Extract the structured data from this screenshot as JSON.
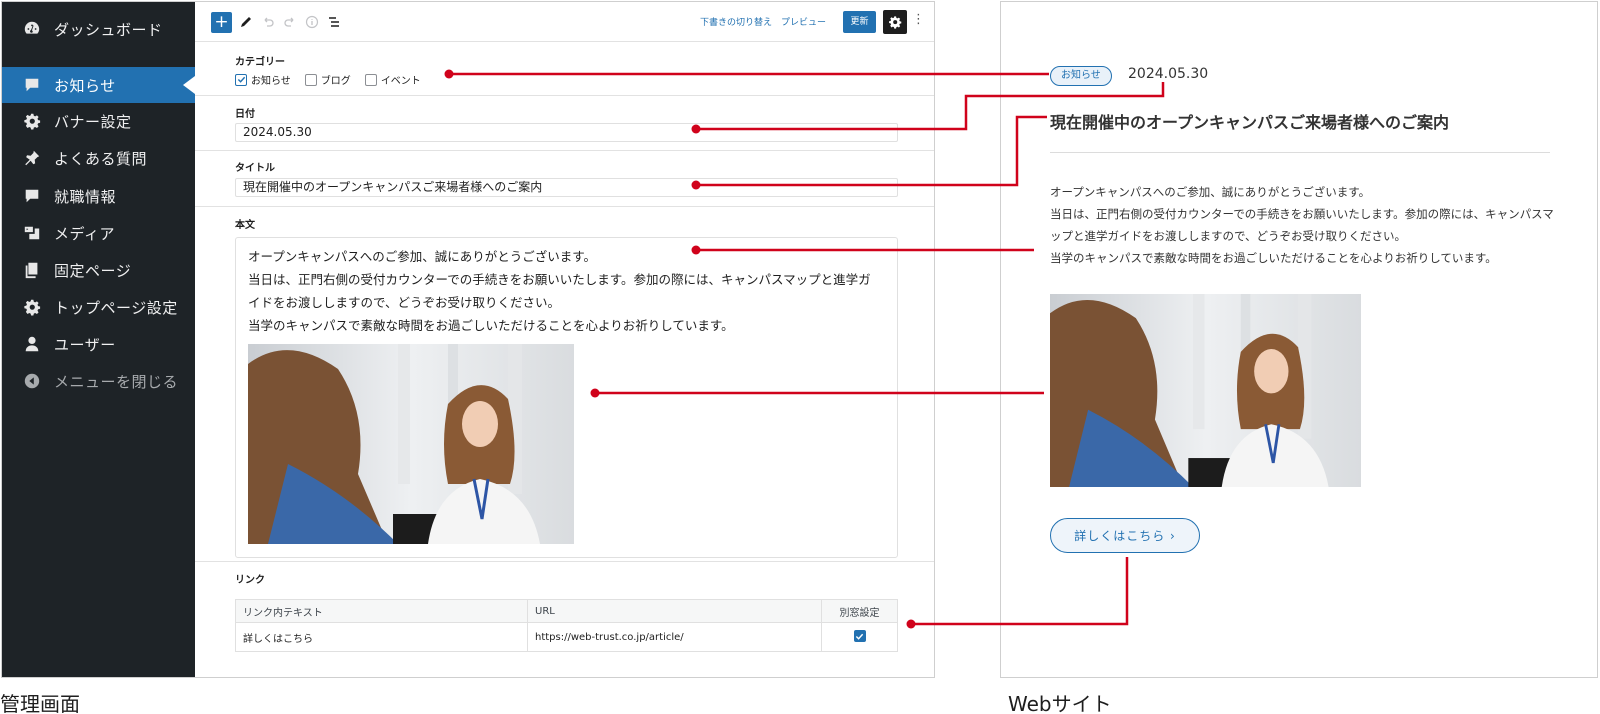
{
  "admin": {
    "sidebar": {
      "items": [
        {
          "label": "ダッシュボード",
          "icon": "dashboard-icon"
        },
        {
          "label": "お知らせ",
          "icon": "comment-icon",
          "active": true
        },
        {
          "label": "バナー設定",
          "icon": "gear-icon"
        },
        {
          "label": "よくある質問",
          "icon": "pin-icon"
        },
        {
          "label": "就職情報",
          "icon": "comment-icon"
        },
        {
          "label": "メディア",
          "icon": "media-icon"
        },
        {
          "label": "固定ページ",
          "icon": "pages-icon"
        },
        {
          "label": "トップページ設定",
          "icon": "gear-icon"
        },
        {
          "label": "ユーザー",
          "icon": "user-icon"
        },
        {
          "label": "メニューを閉じる",
          "icon": "collapse-icon"
        }
      ]
    },
    "toolbar": {
      "add_label": "+",
      "draft_label": "下書きの切り替え",
      "preview_label": "プレビュー",
      "update_label": "更新",
      "more_label": "⋮"
    },
    "fields": {
      "category": {
        "label": "カテゴリー",
        "options": [
          {
            "label": "お知らせ",
            "checked": true
          },
          {
            "label": "ブログ",
            "checked": false
          },
          {
            "label": "イベント",
            "checked": false
          }
        ]
      },
      "date": {
        "label": "日付",
        "value": "2024.05.30"
      },
      "title": {
        "label": "タイトル",
        "value": "現在開催中のオープンキャンパスご来場者様へのご案内"
      },
      "body": {
        "label": "本文",
        "paragraphs": [
          "オープンキャンパスへのご参加、誠にありがとうございます。",
          "当日は、正門右側の受付カウンターでの手続きをお願いいたします。参加の際には、キャンパスマップと進学ガイドをお渡ししますので、どうぞお受け取りください。",
          "当学のキャンパスで素敵な時間をお過ごしいただけることを心よりお祈りしています。"
        ]
      },
      "link": {
        "label": "リンク",
        "headers": [
          "リンク内テキスト",
          "URL",
          "別窓設定"
        ],
        "row": {
          "text": "詳しくはこちら",
          "url": "https://web-trust.co.jp/article/",
          "new_window": true
        }
      }
    },
    "caption": "管理画面"
  },
  "site": {
    "category_badge": "お知らせ",
    "date": "2024.05.30",
    "title": "現在開催中のオープンキャンパスご来場者様へのご案内",
    "paragraphs": [
      "オープンキャンパスへのご参加、誠にありがとうございます。",
      "当日は、正門右側の受付カウンターでの手続きをお願いいたします。参加の際には、キャンパスマップと進学ガイドをお渡ししますので、どうぞお受け取りください。",
      "当学のキャンパスで素敵な時間をお過ごしいただけることを心よりお祈りしています。"
    ],
    "button_label": "詳しくはこちら ›",
    "caption": "Webサイト"
  },
  "colors": {
    "sidebar_bg": "#1e2327",
    "accent": "#2271b1",
    "connector": "#d0021b"
  }
}
